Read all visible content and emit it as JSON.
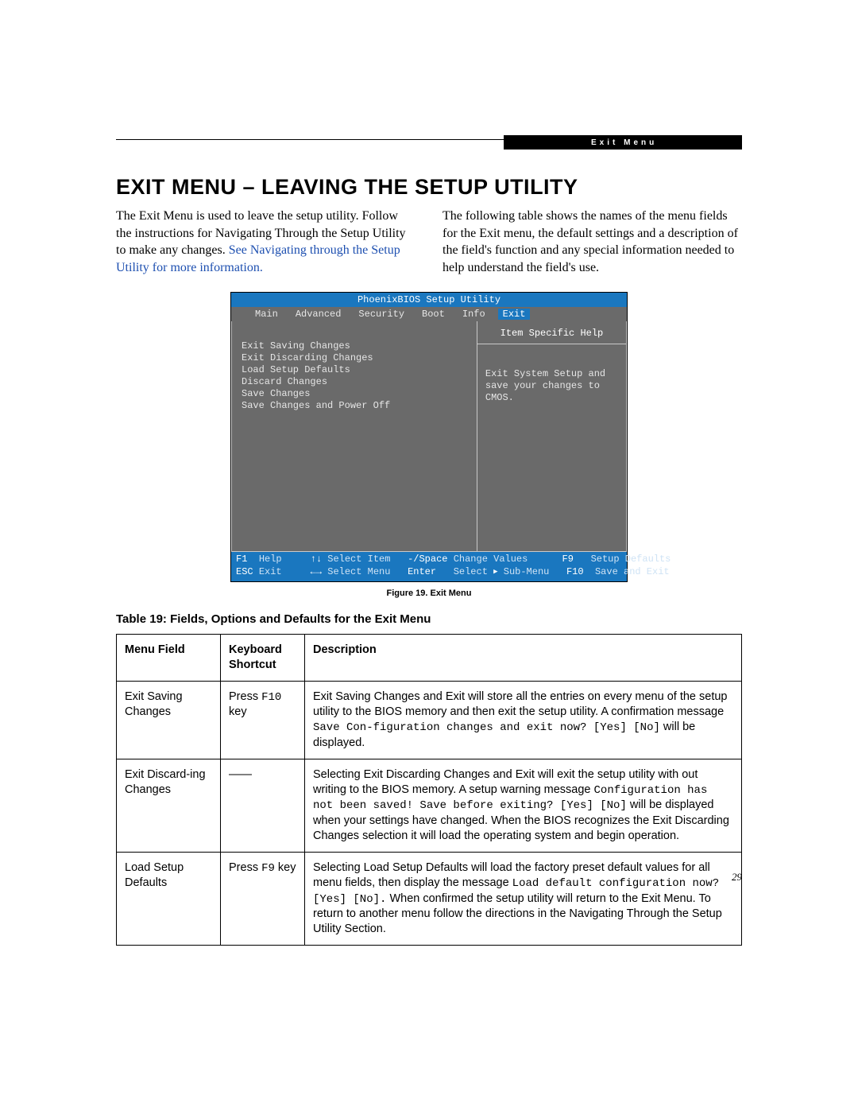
{
  "chip_label": "Exit Menu",
  "heading": "EXIT MENU – LEAVING THE SETUP UTILITY",
  "col_left_a": "The Exit Menu is used to leave the setup utility. Follow the instructions for Navigating Through the Setup Utility to make any changes. ",
  "col_left_link": "See Navigating through the Setup Utility for more information.",
  "col_right": "The following table shows the names of the menu fields for the Exit menu, the default settings and a description of the field's function and any special information needed to help understand the field's use.",
  "bios": {
    "title": "PhoenixBIOS Setup Utility",
    "tabs": [
      "Main",
      "Advanced",
      "Security",
      "Boot",
      "Info",
      "Exit"
    ],
    "active_tab": "Exit",
    "items": [
      "Exit Saving Changes",
      "Exit Discarding Changes",
      "Load Setup Defaults",
      "Discard Changes",
      "Save Changes",
      "Save Changes and Power Off"
    ],
    "help_title": "Item Specific Help",
    "help_body": "Exit System Setup and save your changes to CMOS.",
    "footer": {
      "f1": "F1",
      "help": "Help",
      "arrows_ud": "↑↓",
      "select_item": "Select Item",
      "minus_space": "-/Space",
      "change_values": "Change Values",
      "f9": "F9",
      "setup_defaults": "Setup Defaults",
      "esc": "ESC",
      "exit": "Exit",
      "arrows_lr": "←→",
      "select_menu": "Select Menu",
      "enter": "Enter",
      "select_label": "Select",
      "submenu": "Sub-Menu",
      "f10": "F10",
      "save_exit": "Save and Exit"
    }
  },
  "fig_caption": "Figure 19.  Exit Menu",
  "table_caption": "Table 19: Fields, Options and Defaults for the Exit Menu",
  "table": {
    "headers": [
      "Menu Field",
      "Keyboard Shortcut",
      "Description"
    ],
    "rows": [
      {
        "field": "Exit Saving Changes",
        "shortcut_pre": "Press ",
        "shortcut_mono": "F10",
        "shortcut_post": " key",
        "desc_a": "Exit Saving Changes and Exit will store all the entries on every menu of the setup utility to the BIOS memory and then exit the setup utility. A confirmation message ",
        "desc_mono": "Save Con-figuration changes and exit now? [Yes] [No]",
        "desc_b": " will be displayed."
      },
      {
        "field": "Exit Discard-ing Changes",
        "shortcut_pre": "——",
        "shortcut_mono": "",
        "shortcut_post": "",
        "desc_a": "Selecting Exit Discarding Changes and Exit will exit the setup utility with out writing to the BIOS memory. A setup warning message ",
        "desc_mono": "Configuration has not been saved! Save before exiting? [Yes] [No]",
        "desc_b": " will be displayed when your settings have changed. When the BIOS recognizes the Exit Discarding Changes selection it will load the operating system and begin operation."
      },
      {
        "field": "Load Setup Defaults",
        "shortcut_pre": "Press ",
        "shortcut_mono": "F9",
        "shortcut_post": " key",
        "desc_a": "Selecting Load Setup Defaults will load the factory preset default values for all menu fields, then display the message ",
        "desc_mono": "Load default configuration now? [Yes] [No].",
        "desc_b": " When confirmed the setup utility will return to the Exit Menu. To return to another menu follow the directions in the Navigating Through the Setup Utility Section."
      }
    ]
  },
  "page_number": "29"
}
